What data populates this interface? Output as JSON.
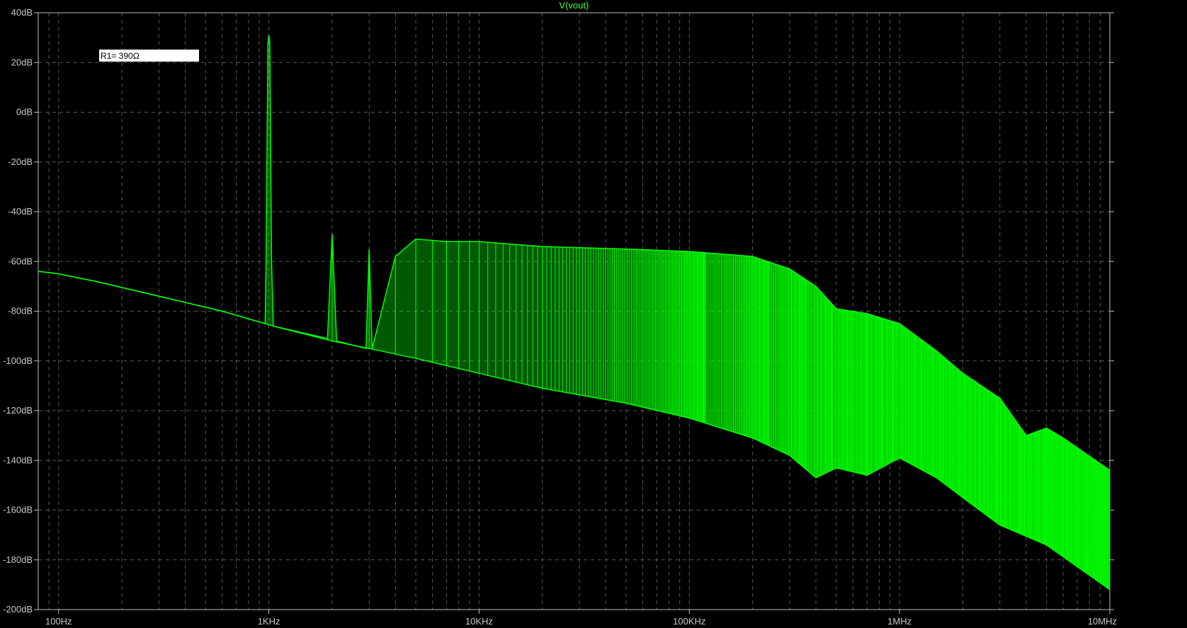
{
  "chart_data": {
    "type": "line",
    "title": "V(vout)",
    "xlabel": "",
    "ylabel": "",
    "x_scale": "log",
    "xlim": [
      80,
      10000000
    ],
    "ylim": [
      -200,
      40
    ],
    "grid": true,
    "x_ticks": [
      {
        "value": 100,
        "label": "100Hz"
      },
      {
        "value": 1000,
        "label": "1KHz"
      },
      {
        "value": 10000,
        "label": "10KHz"
      },
      {
        "value": 100000,
        "label": "100KHz"
      },
      {
        "value": 1000000,
        "label": "1MHz"
      },
      {
        "value": 10000000,
        "label": "10MHz"
      }
    ],
    "y_ticks": [
      {
        "value": 40,
        "label": "40dB"
      },
      {
        "value": 20,
        "label": "20dB"
      },
      {
        "value": 0,
        "label": "0dB"
      },
      {
        "value": -20,
        "label": "-20dB"
      },
      {
        "value": -40,
        "label": "-40dB"
      },
      {
        "value": -60,
        "label": "-60dB"
      },
      {
        "value": -80,
        "label": "-80dB"
      },
      {
        "value": -100,
        "label": "-100dB"
      },
      {
        "value": -120,
        "label": "-120dB"
      },
      {
        "value": -140,
        "label": "-140dB"
      },
      {
        "value": -160,
        "label": "-160dB"
      },
      {
        "value": -180,
        "label": "-180dB"
      },
      {
        "value": -200,
        "label": "-200dB"
      }
    ],
    "series": [
      {
        "name": "V(vout)",
        "color": "#00ff00",
        "floor": [
          [
            80,
            -64
          ],
          [
            100,
            -65
          ],
          [
            150,
            -68
          ],
          [
            300,
            -74
          ],
          [
            600,
            -80
          ],
          [
            960,
            -85
          ],
          [
            1050,
            -86
          ],
          [
            2000,
            -92
          ],
          [
            3000,
            -95
          ],
          [
            5000,
            -99
          ],
          [
            10000,
            -105
          ],
          [
            20000,
            -111
          ],
          [
            50000,
            -117
          ],
          [
            100000,
            -123
          ],
          [
            200000,
            -131
          ],
          [
            300000,
            -138
          ],
          [
            400000,
            -147
          ],
          [
            500000,
            -143
          ],
          [
            700000,
            -146
          ],
          [
            1000000,
            -139
          ],
          [
            1500000,
            -147
          ],
          [
            2000000,
            -155
          ],
          [
            3000000,
            -166
          ],
          [
            5000000,
            -174
          ],
          [
            10000000,
            -192
          ]
        ],
        "envelope": [
          [
            80,
            -64
          ],
          [
            100,
            -65
          ],
          [
            150,
            -68
          ],
          [
            300,
            -74
          ],
          [
            600,
            -80
          ],
          [
            960,
            -85
          ],
          [
            970,
            -60
          ],
          [
            990,
            28
          ],
          [
            1000,
            31
          ],
          [
            1010,
            28
          ],
          [
            1030,
            -60
          ],
          [
            1050,
            -86
          ],
          [
            1900,
            -91
          ],
          [
            2000,
            -49
          ],
          [
            2100,
            -92
          ],
          [
            2900,
            -95
          ],
          [
            3000,
            -55
          ],
          [
            3100,
            -95
          ],
          [
            4000,
            -58
          ],
          [
            5000,
            -51
          ],
          [
            7000,
            -52
          ],
          [
            10000,
            -52
          ],
          [
            20000,
            -54
          ],
          [
            50000,
            -55
          ],
          [
            100000,
            -56
          ],
          [
            200000,
            -58
          ],
          [
            300000,
            -63
          ],
          [
            400000,
            -70
          ],
          [
            500000,
            -79
          ],
          [
            700000,
            -81
          ],
          [
            1000000,
            -85
          ],
          [
            1500000,
            -96
          ],
          [
            2000000,
            -105
          ],
          [
            3000000,
            -115
          ],
          [
            4000000,
            -130
          ],
          [
            5000000,
            -127
          ],
          [
            6000000,
            -131
          ],
          [
            10000000,
            -144
          ]
        ],
        "fundamental": {
          "x": 1000,
          "y": 31
        }
      }
    ]
  },
  "annotation": {
    "label": "R1= 390Ω"
  }
}
